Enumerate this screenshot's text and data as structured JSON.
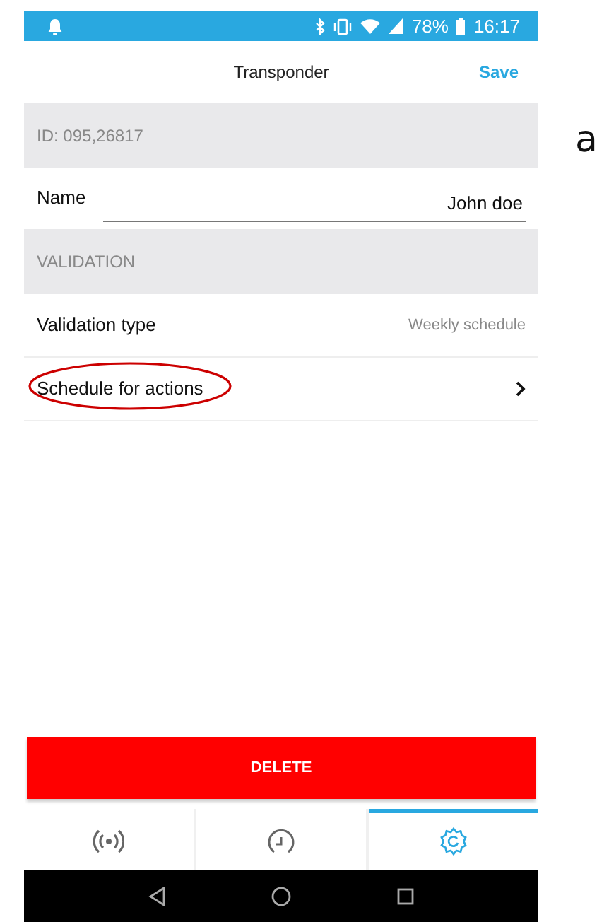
{
  "status_bar": {
    "battery": "78%",
    "time": "16:17"
  },
  "header": {
    "title": "Transponder",
    "action": "Save"
  },
  "id_section": {
    "label": "ID: 095,26817"
  },
  "name_field": {
    "label": "Name",
    "value": "John doe"
  },
  "validation_section": {
    "label": "VALIDATION"
  },
  "rows": [
    {
      "kind": "value",
      "label": "Validation type",
      "value": "Weekly schedule",
      "circled": false
    },
    {
      "kind": "link",
      "label": "Schedule for actions",
      "circled": true
    }
  ],
  "delete_button": "DELETE",
  "tabs": [
    {
      "kind": "signal",
      "selected": false
    },
    {
      "kind": "clock",
      "selected": false
    },
    {
      "kind": "gear",
      "selected": true
    }
  ],
  "figure_label": "a"
}
